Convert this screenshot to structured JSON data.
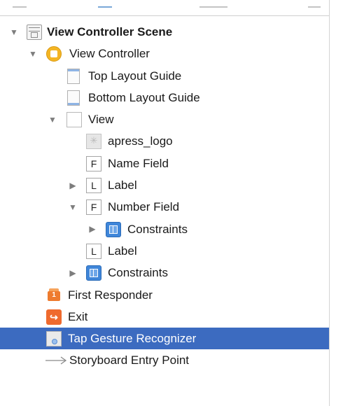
{
  "outline": {
    "items": [
      {
        "label": "View Controller Scene",
        "icon": "scene-icon",
        "disclosure": "expanded"
      },
      {
        "label": "View Controller",
        "icon": "view-controller-icon",
        "disclosure": "expanded"
      },
      {
        "label": "Top Layout Guide",
        "icon": "layout-guide-icon"
      },
      {
        "label": "Bottom Layout Guide",
        "icon": "layout-guide-icon"
      },
      {
        "label": "View",
        "icon": "view-icon",
        "disclosure": "expanded"
      },
      {
        "label": "apress_logo",
        "icon": "image-view-icon"
      },
      {
        "label": "Name Field",
        "icon": "text-field-icon",
        "icon_letter": "F"
      },
      {
        "label": "Label",
        "icon": "label-icon",
        "icon_letter": "L",
        "disclosure": "collapsed"
      },
      {
        "label": "Number Field",
        "icon": "text-field-icon",
        "icon_letter": "F",
        "disclosure": "expanded"
      },
      {
        "label": "Constraints",
        "icon": "constraints-icon",
        "disclosure": "collapsed"
      },
      {
        "label": "Label",
        "icon": "label-icon",
        "icon_letter": "L"
      },
      {
        "label": "Constraints",
        "icon": "constraints-icon",
        "disclosure": "collapsed"
      },
      {
        "label": "First Responder",
        "icon": "first-responder-icon",
        "icon_letter": "1"
      },
      {
        "label": "Exit",
        "icon": "exit-icon",
        "icon_letter": "↪"
      },
      {
        "label": "Tap Gesture Recognizer",
        "icon": "tap-gesture-icon",
        "selected": true
      },
      {
        "label": "Storyboard Entry Point",
        "icon": "entry-arrow-icon"
      }
    ]
  },
  "colors": {
    "selection": "#3c6bc0",
    "view_controller": "#f4b524",
    "constraints": "#3f86d9",
    "exit": "#ef6a2e"
  }
}
